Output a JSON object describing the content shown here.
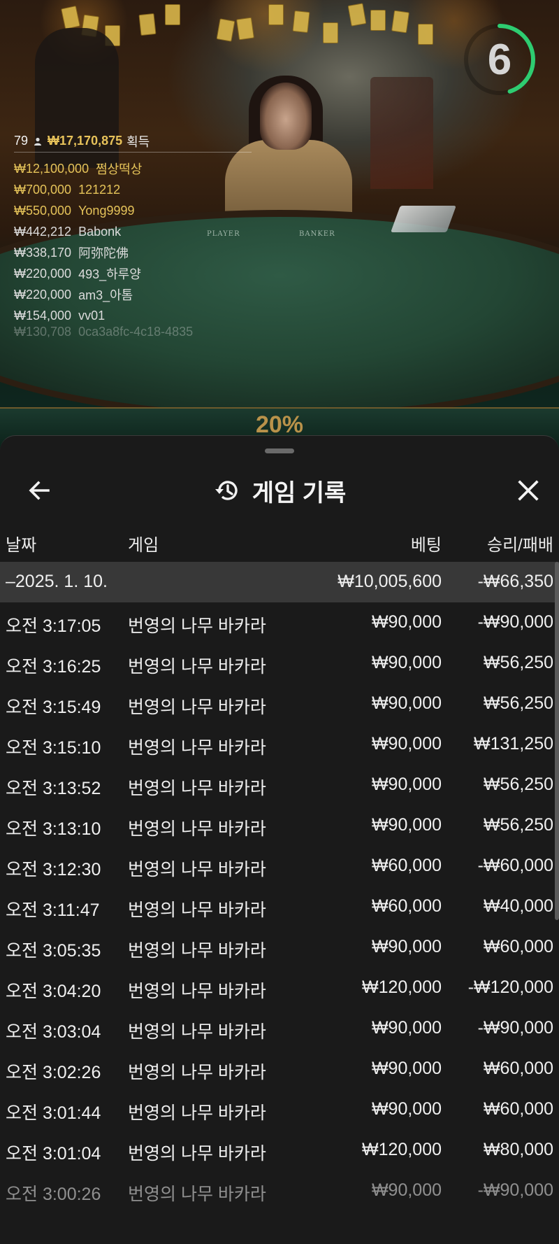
{
  "timer": {
    "value": "6",
    "progress": 0.45,
    "color": "#2ecc71"
  },
  "winners": {
    "count": "79",
    "total": "₩17,170,875",
    "total_suffix": "획득",
    "rows": [
      {
        "amount": "₩12,100,000",
        "name": "쩜상떡상",
        "style": "gold"
      },
      {
        "amount": "₩700,000",
        "name": "121212",
        "style": "gold"
      },
      {
        "amount": "₩550,000",
        "name": "Yong9999",
        "style": "gold"
      },
      {
        "amount": "₩442,212",
        "name": "Babonk",
        "style": "white"
      },
      {
        "amount": "₩338,170",
        "name": "阿弥陀佛",
        "style": "white"
      },
      {
        "amount": "₩220,000",
        "name": "493_하루양",
        "style": "white"
      },
      {
        "amount": "₩220,000",
        "name": "am3_아톰",
        "style": "white"
      },
      {
        "amount": "₩154,000",
        "name": "vv01",
        "style": "white"
      },
      {
        "amount": "₩130,708",
        "name": "0ca3a8fc-4c18-4835",
        "style": "white"
      }
    ]
  },
  "table": {
    "player_label": "PLAYER",
    "banker_label": "BANKER"
  },
  "bottom_percent": "20%",
  "history": {
    "title": "게임 기록",
    "columns": {
      "date": "날짜",
      "game": "게임",
      "bet": "베팅",
      "result": "승리/패배"
    },
    "summary": {
      "date": "–2025. 1. 10.",
      "bet": "₩10,005,600",
      "result": "-₩66,350"
    },
    "rows": [
      {
        "time": "오전 3:17:05",
        "game": "번영의 나무 바카라",
        "bet": "₩90,000",
        "result": "-₩90,000"
      },
      {
        "time": "오전 3:16:25",
        "game": "번영의 나무 바카라",
        "bet": "₩90,000",
        "result": "₩56,250"
      },
      {
        "time": "오전 3:15:49",
        "game": "번영의 나무 바카라",
        "bet": "₩90,000",
        "result": "₩56,250"
      },
      {
        "time": "오전 3:15:10",
        "game": "번영의 나무 바카라",
        "bet": "₩90,000",
        "result": "₩131,250"
      },
      {
        "time": "오전 3:13:52",
        "game": "번영의 나무 바카라",
        "bet": "₩90,000",
        "result": "₩56,250"
      },
      {
        "time": "오전 3:13:10",
        "game": "번영의 나무 바카라",
        "bet": "₩90,000",
        "result": "₩56,250"
      },
      {
        "time": "오전 3:12:30",
        "game": "번영의 나무 바카라",
        "bet": "₩60,000",
        "result": "-₩60,000"
      },
      {
        "time": "오전 3:11:47",
        "game": "번영의 나무 바카라",
        "bet": "₩60,000",
        "result": "₩40,000"
      },
      {
        "time": "오전 3:05:35",
        "game": "번영의 나무 바카라",
        "bet": "₩90,000",
        "result": "₩60,000"
      },
      {
        "time": "오전 3:04:20",
        "game": "번영의 나무 바카라",
        "bet": "₩120,000",
        "result": "-₩120,000"
      },
      {
        "time": "오전 3:03:04",
        "game": "번영의 나무 바카라",
        "bet": "₩90,000",
        "result": "-₩90,000"
      },
      {
        "time": "오전 3:02:26",
        "game": "번영의 나무 바카라",
        "bet": "₩90,000",
        "result": "₩60,000"
      },
      {
        "time": "오전 3:01:44",
        "game": "번영의 나무 바카라",
        "bet": "₩90,000",
        "result": "₩60,000"
      },
      {
        "time": "오전 3:01:04",
        "game": "번영의 나무 바카라",
        "bet": "₩120,000",
        "result": "₩80,000"
      },
      {
        "time": "오전 3:00:26",
        "game": "번영의 나무 바카라",
        "bet": "₩90,000",
        "result": "-₩90,000"
      }
    ]
  },
  "icons": {
    "back": "arrow-left-icon",
    "history": "history-icon",
    "close": "close-icon",
    "user": "user-icon"
  }
}
